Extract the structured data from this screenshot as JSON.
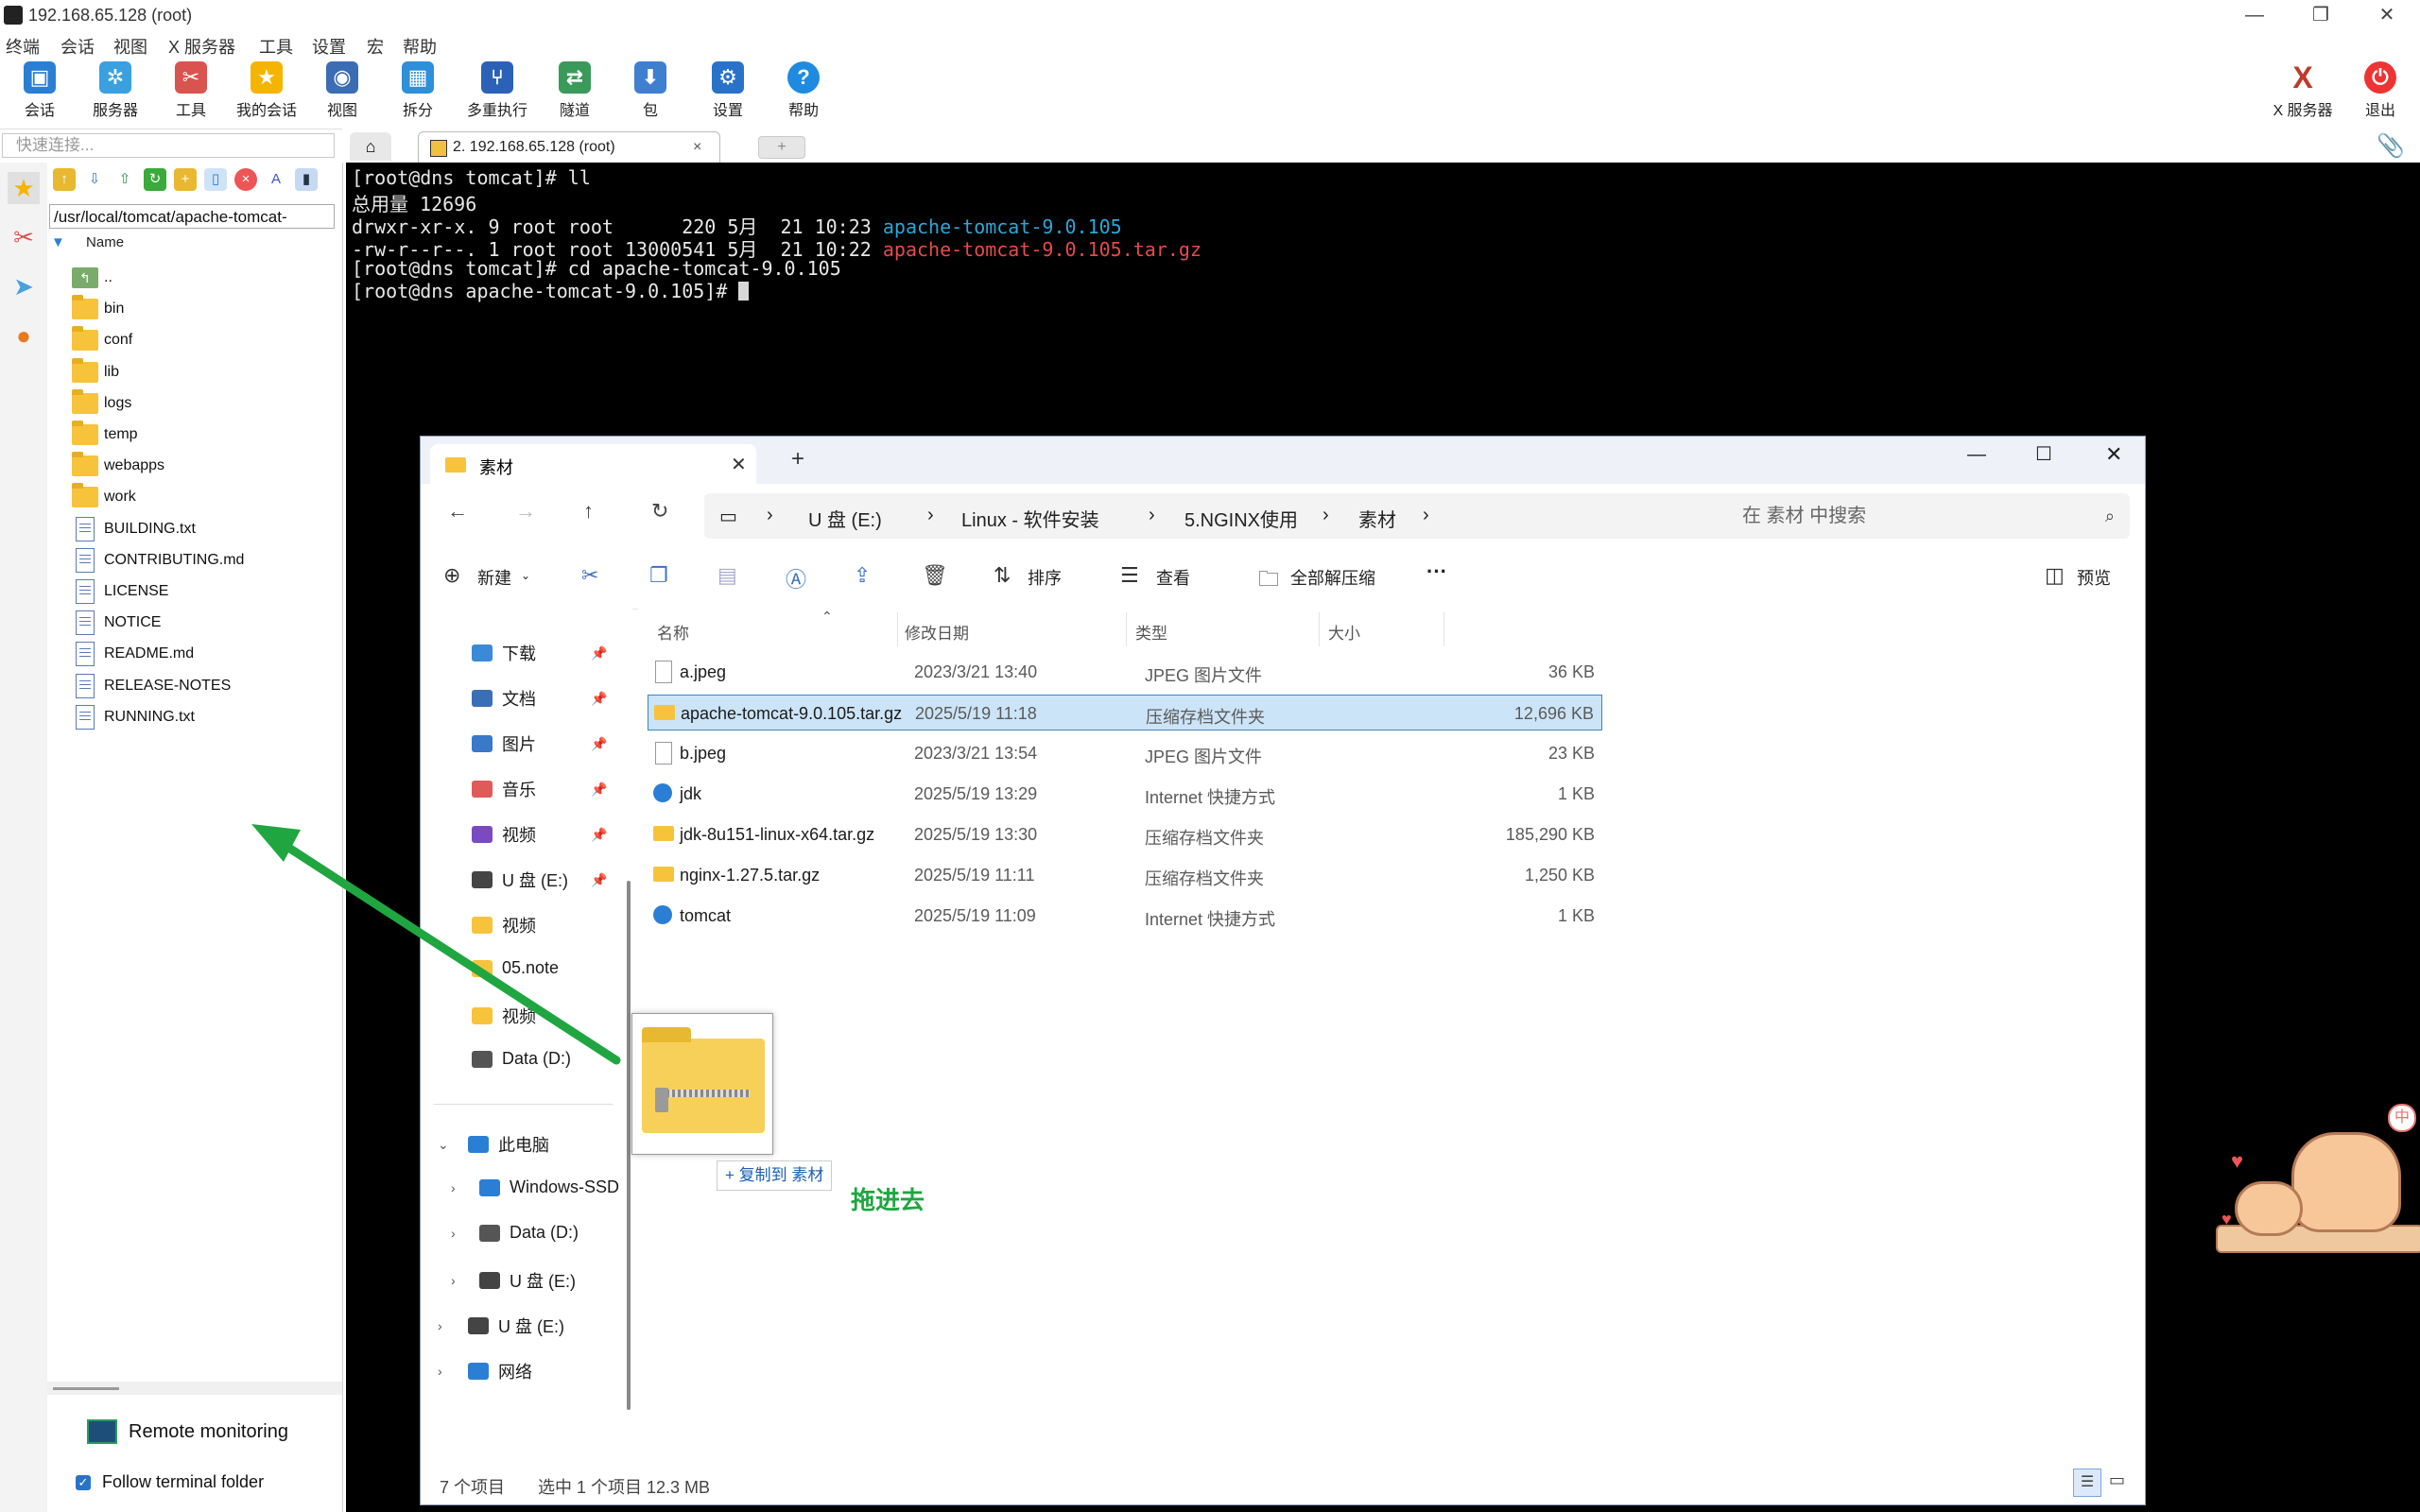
{
  "app": {
    "title": "192.168.65.128  (root)",
    "menu": [
      "终端",
      "会话",
      "视图",
      "X 服务器",
      "工具",
      "设置",
      "宏",
      "帮助"
    ],
    "toolbar": [
      "会话",
      "服务器",
      "工具",
      "我的会话",
      "视图",
      "拆分",
      "多重执行",
      "隧道",
      "包",
      "设置",
      "帮助"
    ],
    "toolbar_right": [
      "X 服务器",
      "退出"
    ],
    "quick_placeholder": "快速连接...",
    "tab_label": "2. 192.168.65.128  (root)"
  },
  "sftp": {
    "path": "/usr/local/tomcat/apache-tomcat-",
    "column": "Name",
    "items": [
      {
        "name": "..",
        "type": "up"
      },
      {
        "name": "bin",
        "type": "folder"
      },
      {
        "name": "conf",
        "type": "folder"
      },
      {
        "name": "lib",
        "type": "folder"
      },
      {
        "name": "logs",
        "type": "folder"
      },
      {
        "name": "temp",
        "type": "folder"
      },
      {
        "name": "webapps",
        "type": "folder"
      },
      {
        "name": "work",
        "type": "folder"
      },
      {
        "name": "BUILDING.txt",
        "type": "doc"
      },
      {
        "name": "CONTRIBUTING.md",
        "type": "doc"
      },
      {
        "name": "LICENSE",
        "type": "doc"
      },
      {
        "name": "NOTICE",
        "type": "doc"
      },
      {
        "name": "README.md",
        "type": "doc"
      },
      {
        "name": "RELEASE-NOTES",
        "type": "doc"
      },
      {
        "name": "RUNNING.txt",
        "type": "doc"
      }
    ],
    "remote_monitoring": "Remote monitoring",
    "follow_folder": "Follow terminal folder"
  },
  "terminal": {
    "lines": [
      {
        "text": "[root@dns tomcat]# ll"
      },
      {
        "text": "总用量 12696"
      },
      {
        "text": "drwxr-xr-x. 9 root root      220 5月  21 10:23 ",
        "hl": "apache-tomcat-9.0.105",
        "hlc": "cyan"
      },
      {
        "text": "-rw-r--r--. 1 root root 13000541 5月  21 10:22 ",
        "hl": "apache-tomcat-9.0.105.tar.gz",
        "hlc": "red"
      },
      {
        "text": "[root@dns tomcat]# cd apache-tomcat-9.0.105"
      },
      {
        "text": "[root@dns apache-tomcat-9.0.105]# ",
        "cursor": true
      }
    ]
  },
  "explorer": {
    "tab_title": "素材",
    "breadcrumbs": [
      "U 盘 (E:)",
      "Linux - 软件安装",
      "5.NGINX使用",
      "素材"
    ],
    "search_placeholder": "在 素材 中搜索",
    "commands": {
      "new": "新建",
      "sort": "排序",
      "view": "查看",
      "extract": "全部解压缩",
      "more": "···",
      "preview": "预览"
    },
    "nav": [
      "下载",
      "文档",
      "图片",
      "音乐",
      "视频",
      "U 盘 (E:)",
      "视频",
      "05.note",
      "视频",
      "Data (D:)",
      "此电脑",
      "Windows-SSD",
      "Data (D:)",
      "U 盘 (E:)",
      "U 盘 (E:)",
      "网络"
    ],
    "headers": [
      "名称",
      "修改日期",
      "类型",
      "大小"
    ],
    "files": [
      {
        "name": "a.jpeg",
        "date": "2023/3/21 13:40",
        "type": "JPEG 图片文件",
        "size": "36 KB",
        "icon": "doc"
      },
      {
        "name": "apache-tomcat-9.0.105.tar.gz",
        "date": "2025/5/19 11:18",
        "type": "压缩存档文件夹",
        "size": "12,696 KB",
        "icon": "zip",
        "selected": true
      },
      {
        "name": "b.jpeg",
        "date": "2023/3/21 13:54",
        "type": "JPEG 图片文件",
        "size": "23 KB",
        "icon": "doc"
      },
      {
        "name": "jdk",
        "date": "2025/5/19 13:29",
        "type": "Internet 快捷方式",
        "size": "1 KB",
        "icon": "web"
      },
      {
        "name": "jdk-8u151-linux-x64.tar.gz",
        "date": "2025/5/19 13:30",
        "type": "压缩存档文件夹",
        "size": "185,290 KB",
        "icon": "zip"
      },
      {
        "name": "nginx-1.27.5.tar.gz",
        "date": "2025/5/19 11:11",
        "type": "压缩存档文件夹",
        "size": "1,250 KB",
        "icon": "zip"
      },
      {
        "name": "tomcat",
        "date": "2025/5/19 11:09",
        "type": "Internet 快捷方式",
        "size": "1 KB",
        "icon": "web"
      }
    ],
    "status_count": "7 个项目",
    "status_selected": "选中 1 个项目  12.3 MB"
  },
  "drag": {
    "copy_to": "+ 复制到 素材",
    "hint": "拖进去"
  },
  "colors": {
    "terminal_bg": "#000000",
    "cyan": "#2aa8d8",
    "red": "#e84a4a",
    "arrow": "#1fa640",
    "selection": "#cce4f7"
  }
}
